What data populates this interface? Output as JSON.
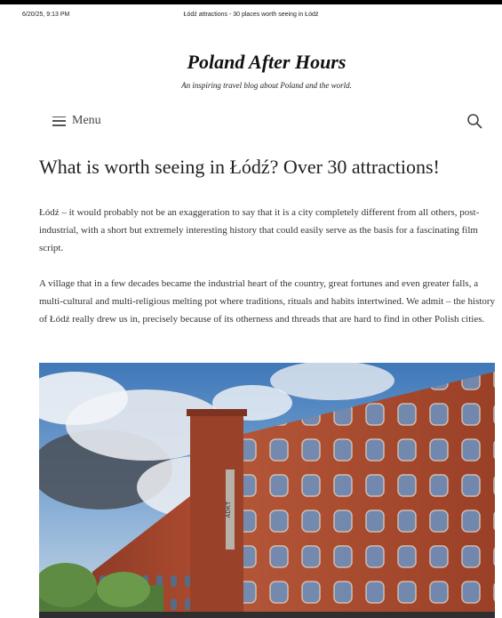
{
  "print_header": {
    "datetime": "6/20/25, 9:13 PM",
    "page_title": "Łódź attractions - 30 places worth seeing in Łódź"
  },
  "site": {
    "title": "Poland After Hours",
    "tagline": "An inspiring travel blog about Poland and the world."
  },
  "nav": {
    "menu_label": "Menu",
    "menu_icon": "hamburger-icon",
    "search_icon": "search-icon"
  },
  "article": {
    "heading": "What is worth seeing in Łódź? Over 30 attractions!",
    "paragraphs": [
      "Łódź – it would probably not be an exaggeration to say that it is a city completely different from all others, post-industrial, with a short but extremely interesting history that could easily serve as the basis for a fascinating film script.",
      "A village that in a few decades became the industrial heart of the country, great fortunes and even greater falls, a multi-cultural and multi-religious melting pot where traditions, rituals and habits intertwined. We admit – the history of Łódź really drew us in, precisely because of its otherness and threads that are hard to find in other Polish cities."
    ],
    "hero_sign": "ADKT"
  },
  "colors": {
    "brick": "#a4452c",
    "sky": "#4f86c2",
    "window": "#5c86b5"
  }
}
